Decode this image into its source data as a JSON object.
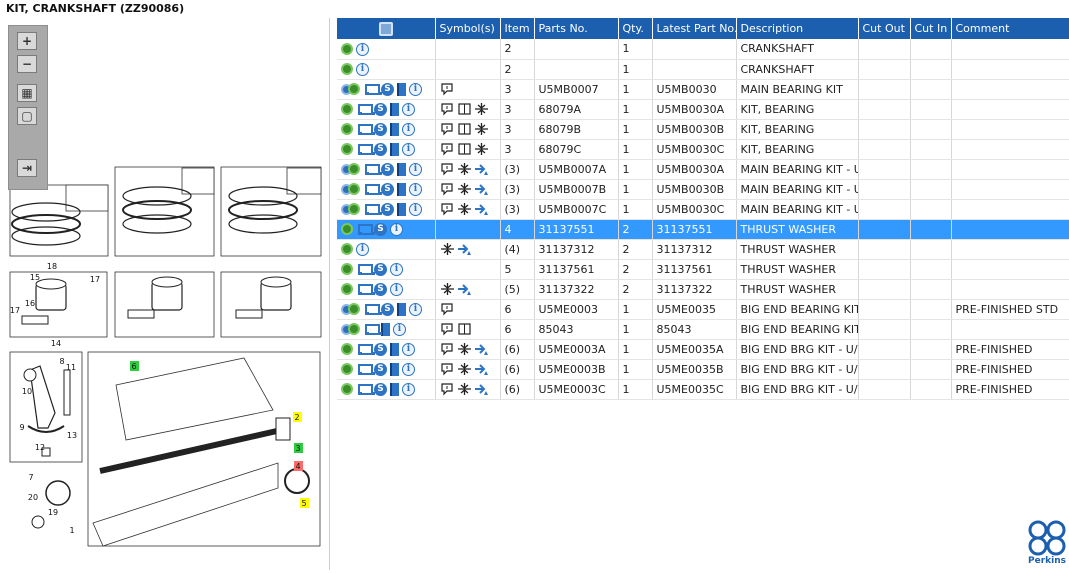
{
  "title": "KIT, CRANKSHAFT (ZZ90086)",
  "colors": {
    "header_bg": "#1c5fae",
    "selected_row": "#3399ff",
    "icon_blue": "#2d74c4",
    "icon_green": "#3b8f2a"
  },
  "toolbar": {
    "zoom_in": "+",
    "zoom_out": "−",
    "fit": "▦",
    "frame": "▢",
    "export": "⇥"
  },
  "illustration": {
    "callouts": [
      "18",
      "15",
      "16",
      "17",
      "17",
      "14",
      "8",
      "11",
      "10",
      "9",
      "13",
      "12",
      "7",
      "20",
      "19",
      "1",
      "6",
      "2",
      "3",
      "4",
      "5"
    ]
  },
  "table": {
    "headers": [
      "",
      "Symbol(s)",
      "Item",
      "Parts No.",
      "Qty.",
      "Latest Part No.",
      "Description",
      "Cut Out",
      "Cut In",
      "Comment"
    ],
    "rows": [
      {
        "icons": [
          "gear-icon",
          "info-icon"
        ],
        "symbols": [],
        "item": "2",
        "part_no": "",
        "qty": "1",
        "latest": "",
        "desc": "CRANKSHAFT",
        "cut_out": "",
        "cut_in": "",
        "comment": "",
        "selected": false
      },
      {
        "icons": [
          "gear-icon",
          "info-icon"
        ],
        "symbols": [],
        "item": "2",
        "part_no": "",
        "qty": "1",
        "latest": "",
        "desc": "CRANKSHAFT",
        "cut_out": "",
        "cut_in": "",
        "comment": "",
        "selected": false
      },
      {
        "icons": [
          "gears-icon",
          "cart-icon",
          "s-icon",
          "book-icon",
          "info-icon"
        ],
        "symbols": [
          "note-symbol"
        ],
        "item": "3",
        "part_no": "U5MB0007",
        "qty": "1",
        "latest": "U5MB0030",
        "desc": "MAIN BEARING KIT",
        "cut_out": "",
        "cut_in": "",
        "comment": "",
        "selected": false
      },
      {
        "icons": [
          "gear-icon",
          "cart-icon",
          "s-icon",
          "book-icon",
          "info-icon"
        ],
        "symbols": [
          "note-symbol",
          "manual-symbol",
          "fit-symbol"
        ],
        "item": "3",
        "part_no": "68079A",
        "qty": "1",
        "latest": "U5MB0030A",
        "desc": "KIT, BEARING",
        "cut_out": "",
        "cut_in": "",
        "comment": "",
        "selected": false
      },
      {
        "icons": [
          "gear-icon",
          "cart-icon",
          "s-icon",
          "book-icon",
          "info-icon"
        ],
        "symbols": [
          "note-symbol",
          "manual-symbol",
          "fit-symbol"
        ],
        "item": "3",
        "part_no": "68079B",
        "qty": "1",
        "latest": "U5MB0030B",
        "desc": "KIT, BEARING",
        "cut_out": "",
        "cut_in": "",
        "comment": "",
        "selected": false
      },
      {
        "icons": [
          "gear-icon",
          "cart-icon",
          "s-icon",
          "book-icon",
          "info-icon"
        ],
        "symbols": [
          "note-symbol",
          "manual-symbol",
          "fit-symbol"
        ],
        "item": "3",
        "part_no": "68079C",
        "qty": "1",
        "latest": "U5MB0030C",
        "desc": "KIT, BEARING",
        "cut_out": "",
        "cut_in": "",
        "comment": "",
        "selected": false
      },
      {
        "icons": [
          "gears-icon",
          "cart-icon",
          "s-icon",
          "book-icon",
          "info-icon"
        ],
        "symbols": [
          "note-symbol",
          "fit-symbol",
          "arrow-symbol"
        ],
        "item": "(3)",
        "part_no": "U5MB0007A",
        "qty": "1",
        "latest": "U5MB0030A",
        "desc": "MAIN BEARING KIT - U/S",
        "cut_out": "",
        "cut_in": "",
        "comment": "",
        "selected": false
      },
      {
        "icons": [
          "gears-icon",
          "cart-icon",
          "s-icon",
          "book-icon",
          "info-icon"
        ],
        "symbols": [
          "note-symbol",
          "fit-symbol",
          "arrow-symbol"
        ],
        "item": "(3)",
        "part_no": "U5MB0007B",
        "qty": "1",
        "latest": "U5MB0030B",
        "desc": "MAIN BEARING KIT - U/S",
        "cut_out": "",
        "cut_in": "",
        "comment": "",
        "selected": false
      },
      {
        "icons": [
          "gears-icon",
          "cart-icon",
          "s-icon",
          "book-icon",
          "info-icon"
        ],
        "symbols": [
          "note-symbol",
          "fit-symbol",
          "arrow-symbol"
        ],
        "item": "(3)",
        "part_no": "U5MB0007C",
        "qty": "1",
        "latest": "U5MB0030C",
        "desc": "MAIN BEARING KIT - U/S",
        "cut_out": "",
        "cut_in": "",
        "comment": "",
        "selected": false
      },
      {
        "icons": [
          "gear-icon",
          "cart-icon",
          "s-icon",
          "info-icon"
        ],
        "symbols": [],
        "item": "4",
        "part_no": "31137551",
        "qty": "2",
        "latest": "31137551",
        "desc": "THRUST WASHER",
        "cut_out": "",
        "cut_in": "",
        "comment": "",
        "selected": true
      },
      {
        "icons": [
          "gear-icon",
          "info-icon"
        ],
        "symbols": [
          "fit-symbol",
          "arrow-symbol"
        ],
        "item": "(4)",
        "part_no": "31137312",
        "qty": "2",
        "latest": "31137312",
        "desc": "THRUST WASHER",
        "cut_out": "",
        "cut_in": "",
        "comment": "",
        "selected": false
      },
      {
        "icons": [
          "gear-icon",
          "cart-icon",
          "s-icon",
          "info-icon"
        ],
        "symbols": [],
        "item": "5",
        "part_no": "31137561",
        "qty": "2",
        "latest": "31137561",
        "desc": "THRUST WASHER",
        "cut_out": "",
        "cut_in": "",
        "comment": "",
        "selected": false
      },
      {
        "icons": [
          "gear-icon",
          "cart-icon",
          "s-icon",
          "info-icon"
        ],
        "symbols": [
          "fit-symbol",
          "arrow-symbol"
        ],
        "item": "(5)",
        "part_no": "31137322",
        "qty": "2",
        "latest": "31137322",
        "desc": "THRUST WASHER",
        "cut_out": "",
        "cut_in": "",
        "comment": "",
        "selected": false
      },
      {
        "icons": [
          "gears-icon",
          "cart-icon",
          "s-icon",
          "book-icon",
          "info-icon"
        ],
        "symbols": [
          "note-symbol"
        ],
        "item": "6",
        "part_no": "U5ME0003",
        "qty": "1",
        "latest": "U5ME0035",
        "desc": "BIG END BEARING KIT",
        "cut_out": "",
        "cut_in": "",
        "comment": "PRE-FINISHED  STD",
        "selected": false
      },
      {
        "icons": [
          "gears-icon",
          "cart-icon",
          "book-icon",
          "info-icon"
        ],
        "symbols": [
          "note-symbol",
          "manual-symbol"
        ],
        "item": "6",
        "part_no": "85043",
        "qty": "1",
        "latest": "85043",
        "desc": "BIG END BEARING KIT",
        "cut_out": "",
        "cut_in": "",
        "comment": "",
        "selected": false
      },
      {
        "icons": [
          "gear-icon",
          "cart-icon",
          "s-icon",
          "book-icon",
          "info-icon"
        ],
        "symbols": [
          "note-symbol",
          "fit-symbol",
          "arrow-symbol"
        ],
        "item": "(6)",
        "part_no": "U5ME0003A",
        "qty": "1",
        "latest": "U5ME0035A",
        "desc": "BIG END BRG KIT - U/S",
        "cut_out": "",
        "cut_in": "",
        "comment": "PRE-FINISHED",
        "selected": false
      },
      {
        "icons": [
          "gear-icon",
          "cart-icon",
          "s-icon",
          "book-icon",
          "info-icon"
        ],
        "symbols": [
          "note-symbol",
          "fit-symbol",
          "arrow-symbol"
        ],
        "item": "(6)",
        "part_no": "U5ME0003B",
        "qty": "1",
        "latest": "U5ME0035B",
        "desc": "BIG END BRG KIT - U/S",
        "cut_out": "",
        "cut_in": "",
        "comment": "PRE-FINISHED",
        "selected": false
      },
      {
        "icons": [
          "gear-icon",
          "cart-icon",
          "s-icon",
          "book-icon",
          "info-icon"
        ],
        "symbols": [
          "note-symbol",
          "fit-symbol",
          "arrow-symbol"
        ],
        "item": "(6)",
        "part_no": "U5ME0003C",
        "qty": "1",
        "latest": "U5ME0035C",
        "desc": "BIG END BRG KIT - U/S",
        "cut_out": "",
        "cut_in": "",
        "comment": "PRE-FINISHED",
        "selected": false
      }
    ]
  },
  "logo": {
    "text": "Perkins"
  }
}
